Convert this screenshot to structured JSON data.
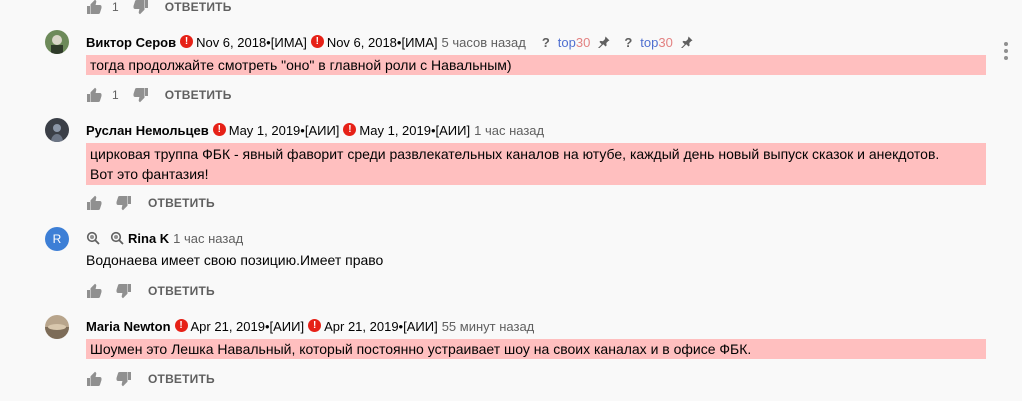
{
  "labels": {
    "reply": "ОТВЕТИТЬ",
    "question": "?",
    "top_a": "top",
    "top_b": "30"
  },
  "top_toolbar": {
    "likes": "1"
  },
  "comments": [
    {
      "author": "Виктор Серов",
      "tag1": "Nov 6, 2018•[ИМА]",
      "tag2": "Nov 6, 2018•[ИМА]",
      "time": "5 часов назад",
      "text": "тогда продолжайте смотреть \"оно\" в главной роли с Навальным)",
      "likes": "1"
    },
    {
      "author": "Руслан Немольцев",
      "tag1": "May 1, 2019•[АИИ]",
      "tag2": "May 1, 2019•[АИИ]",
      "time": "1 час назад",
      "text_line1": "цирковая труппа ФБК - явный фаворит среди развлекательных каналов на ютубе, каждый день новый выпуск сказок и анекдотов.",
      "text_line2": "Вот это фантазия!"
    },
    {
      "avatar_letter": "R",
      "author": "Rina K",
      "time": "1 час назад",
      "text": "Водонаева имеет свою позицию.Имеет право"
    },
    {
      "author": "Maria Newton",
      "tag1": "Apr 21, 2019•[АИИ]",
      "tag2": "Apr 21, 2019•[АИИ]",
      "time": "55 минут назад",
      "text": "Шоумен это Лешка Навальный, который постоянно устраивает шоу на своих каналах и в офисе ФБК."
    }
  ],
  "colors": {
    "highlight": "#ffbfbf",
    "warning": "#e62117",
    "muted": "#606060",
    "avatar_r": "#3d7fd6"
  },
  "icons": [
    "thumb-up-icon",
    "thumb-down-icon",
    "warning-icon",
    "pin-icon",
    "search-icon",
    "more-vert-icon"
  ]
}
